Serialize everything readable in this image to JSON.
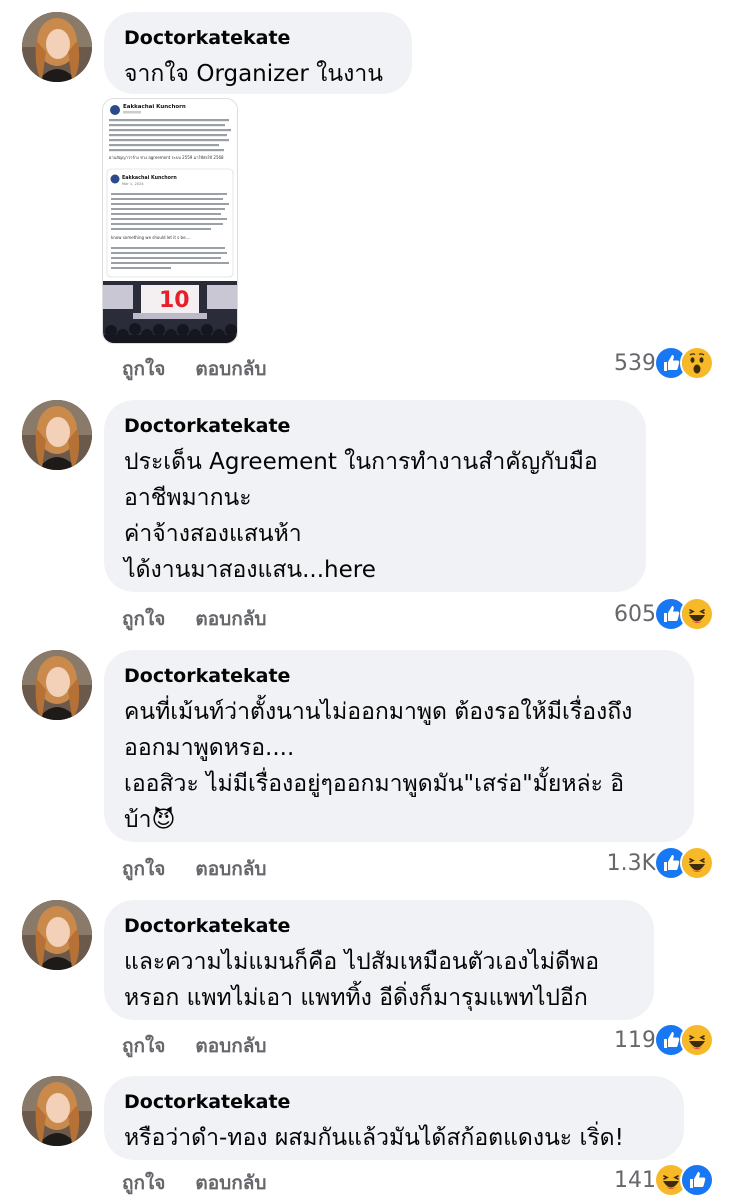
{
  "comments": [
    {
      "author": "Doctorkatekate",
      "lines": [
        "จากใจ Organizer ในงาน"
      ],
      "like_label": "ถูกใจ",
      "reply_label": "ตอบกลับ",
      "count": "539",
      "reactions": [
        "like-icon",
        "wow-icon"
      ],
      "attachment": {
        "post_author": "Eakkachai Kunchorn",
        "quoted_author": "Eakkachai Kunchorn",
        "quoted_date": "Mar 1, 2024",
        "contract_text": "ผ่านสัญญาว่าจ้าง ช่วง agreement ระบบ 2559 มาใช้ยังใช้ 2568",
        "quote_excerpt": "know something we should let it s be....",
        "photo_logo": "10"
      }
    },
    {
      "author": "Doctorkatekate",
      "lines": [
        "ประเด็น Agreement ในการทำงานสำคัญกับมือ",
        "อาชีพมากนะ",
        "ค่าจ้างสองแสนห้า",
        "ได้งานมาสองแสน...here"
      ],
      "like_label": "ถูกใจ",
      "reply_label": "ตอบกลับ",
      "count": "605",
      "reactions": [
        "like-icon",
        "haha-icon"
      ]
    },
    {
      "author": "Doctorkatekate",
      "lines": [
        "คนที่เม้นท์ว่าตั้งนานไม่ออกมาพูด ต้องรอให้มีเรื่องถึง",
        "ออกมาพูดหรอ....",
        "เออสิวะ ไม่มีเรื่องอยู่ๆออกมาพูดมัน\"เสร่อ\"มั้ยหล่ะ อิ",
        "บ้า😈"
      ],
      "like_label": "ถูกใจ",
      "reply_label": "ตอบกลับ",
      "count": "1.3K",
      "reactions": [
        "like-icon",
        "haha-icon"
      ]
    },
    {
      "author": "Doctorkatekate",
      "lines": [
        "และความไม่แมนก็คือ ไปสัมเหมือนตัวเองไม่ดีพอ",
        "หรอก แพทไม่เอา แพททิ้ง อีดิ่งก็มารุมแพทไปอีก"
      ],
      "like_label": "ถูกใจ",
      "reply_label": "ตอบกลับ",
      "count": "119",
      "reactions": [
        "like-icon",
        "haha-icon"
      ]
    },
    {
      "author": "Doctorkatekate",
      "lines": [
        "หรือว่าดำ-ทอง ผสมกันแล้วมันได้สก้อตแดงนะ เริ่ด!"
      ],
      "like_label": "ถูกใจ",
      "reply_label": "ตอบกลับ",
      "count": "141",
      "reactions": [
        "haha-icon",
        "like-icon"
      ]
    }
  ],
  "colors": {
    "bubble": "#f0f2f5",
    "like_blue": "#1877f2",
    "haha_yellow": "#f7b928",
    "meta_gray": "#65676b"
  }
}
